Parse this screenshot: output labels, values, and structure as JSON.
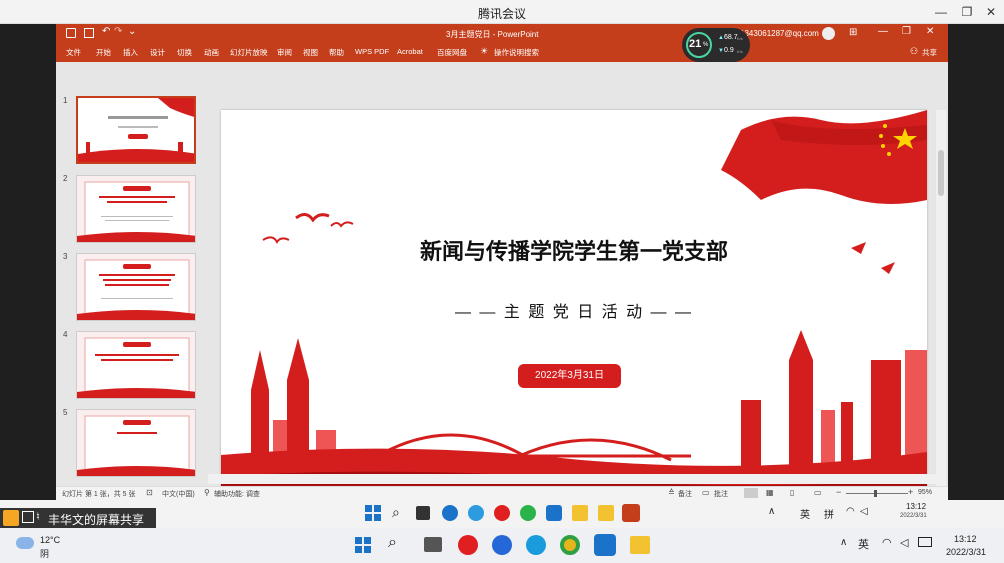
{
  "meeting": {
    "app_title": "腾讯会议",
    "share_label": "丰华文的屏幕共享"
  },
  "ppt": {
    "window_title": "3月主题党日 - PowerPoint",
    "account": "1343061287@qq.com",
    "share_label": "共享",
    "tabs": [
      "文件",
      "开始",
      "插入",
      "设计",
      "切换",
      "动画",
      "幻灯片放映",
      "审阅",
      "视图",
      "帮助",
      "WPS PDF",
      "Acrobat",
      "百度网盘",
      "操作说明搜索"
    ],
    "perf": {
      "cpu": "21",
      "cpu_unit": "%",
      "up": "68.7",
      "up_unit": "K/s",
      "down": "0.9",
      "down_unit": "K/s"
    },
    "thumb_numbers": [
      "1",
      "2",
      "3",
      "4",
      "5"
    ],
    "slide": {
      "title": "新闻与传播学院学生第一党支部",
      "subtitle": "— — 主 题 党 日 活 动 — —",
      "date": "2022年3月31日"
    },
    "status": {
      "slide_info": "幻灯片 第 1 张，共 5 张",
      "language": "中文(中国)",
      "accessibility": "辅助功能: 调查",
      "notes": "备注",
      "comments": "批注",
      "zoom": "95%"
    }
  },
  "meeting_toolbar": {
    "ime_en": "英",
    "ime_pinyin": "拼",
    "time": "13:12",
    "date_short": "2022/3/31"
  },
  "taskbar": {
    "weather_temp": "12°C",
    "weather_desc": "阴",
    "ime": "英",
    "time": "13:12",
    "date": "2022/3/31"
  },
  "colors": {
    "ppt_accent": "#c43e1c",
    "party_red": "#d41e1e"
  }
}
